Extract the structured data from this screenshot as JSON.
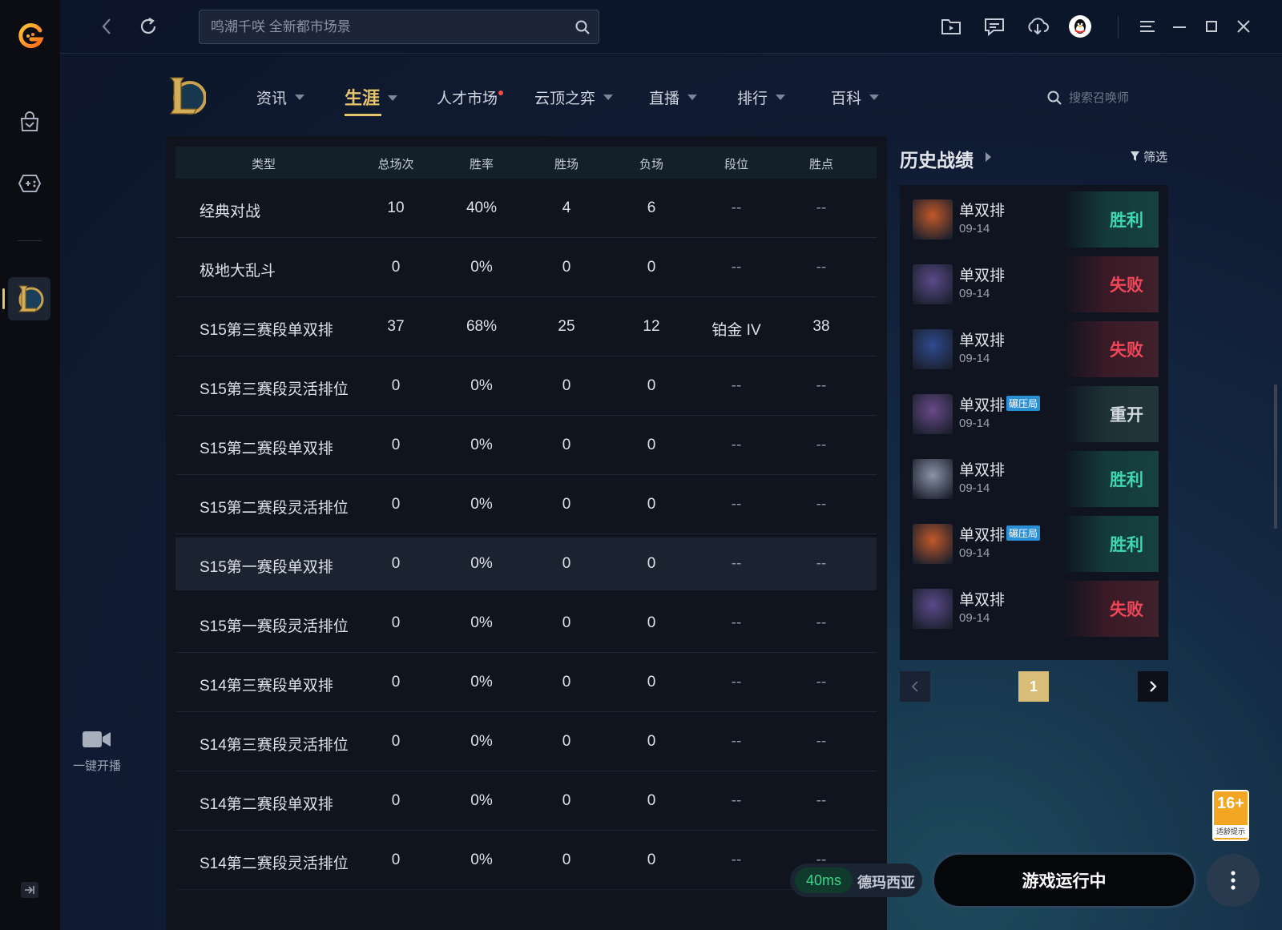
{
  "app": {
    "search": {
      "placeholder": "鸣潮千咲 全新都市场景"
    }
  },
  "game_nav": {
    "items": [
      {
        "label": "资讯",
        "caret": true
      },
      {
        "label": "生涯",
        "caret": true,
        "active": true
      },
      {
        "label": "人才市场",
        "dot": true
      },
      {
        "label": "云顶之弈",
        "caret": true
      },
      {
        "label": "直播",
        "caret": true
      },
      {
        "label": "排行",
        "caret": true
      },
      {
        "label": "百科",
        "caret": true
      }
    ],
    "summoner_search_placeholder": "搜索召唤师"
  },
  "stats_table": {
    "headers": [
      "类型",
      "总场次",
      "胜率",
      "胜场",
      "负场",
      "段位",
      "胜点"
    ],
    "rows": [
      [
        "经典对战",
        "10",
        "40%",
        "4",
        "6",
        "--",
        "--"
      ],
      [
        "极地大乱斗",
        "0",
        "0%",
        "0",
        "0",
        "--",
        "--"
      ],
      [
        "S15第三赛段单双排",
        "37",
        "68%",
        "25",
        "12",
        "铂金 IV",
        "38"
      ],
      [
        "S15第三赛段灵活排位",
        "0",
        "0%",
        "0",
        "0",
        "--",
        "--"
      ],
      [
        "S15第二赛段单双排",
        "0",
        "0%",
        "0",
        "0",
        "--",
        "--"
      ],
      [
        "S15第二赛段灵活排位",
        "0",
        "0%",
        "0",
        "0",
        "--",
        "--"
      ],
      [
        "S15第一赛段单双排",
        "0",
        "0%",
        "0",
        "0",
        "--",
        "--"
      ],
      [
        "S15第一赛段灵活排位",
        "0",
        "0%",
        "0",
        "0",
        "--",
        "--"
      ],
      [
        "S14第三赛段单双排",
        "0",
        "0%",
        "0",
        "0",
        "--",
        "--"
      ],
      [
        "S14第三赛段灵活排位",
        "0",
        "0%",
        "0",
        "0",
        "--",
        "--"
      ],
      [
        "S14第二赛段单双排",
        "0",
        "0%",
        "0",
        "0",
        "--",
        "--"
      ],
      [
        "S14第二赛段灵活排位",
        "0",
        "0%",
        "0",
        "0",
        "--",
        "--"
      ]
    ]
  },
  "history": {
    "title": "历史战绩",
    "filter_label": "筛选",
    "matches": [
      {
        "mode": "单双排",
        "date": "09-14",
        "result": "胜利",
        "result_type": "win",
        "avatar_color": "#c2582a"
      },
      {
        "mode": "单双排",
        "date": "09-14",
        "result": "失败",
        "result_type": "lose",
        "avatar_color": "#5b4a8a"
      },
      {
        "mode": "单双排",
        "date": "09-14",
        "result": "失败",
        "result_type": "lose",
        "avatar_color": "#2f4a8f"
      },
      {
        "mode": "单双排",
        "date": "09-14",
        "result": "重开",
        "result_type": "remake",
        "badge": "碾压局",
        "avatar_color": "#6a4a8a"
      },
      {
        "mode": "单双排",
        "date": "09-14",
        "result": "胜利",
        "result_type": "win",
        "avatar_color": "#8a94a8"
      },
      {
        "mode": "单双排",
        "date": "09-14",
        "result": "胜利",
        "result_type": "win",
        "badge": "碾压局",
        "avatar_color": "#c2582a"
      },
      {
        "mode": "单双排",
        "date": "09-14",
        "result": "失败",
        "result_type": "lose",
        "avatar_color": "#5b4a8a"
      }
    ],
    "current_page": "1"
  },
  "sidebar": {
    "live_label": "一键开播"
  },
  "footer": {
    "ping": "40ms",
    "server": "德玛西亚",
    "run_button": "游戏运行中",
    "age_rating": "16+",
    "age_sub": "适龄提示"
  },
  "colors": {
    "accent": "#e6c46b",
    "win": "#3fd6b4",
    "lose": "#f0485a"
  }
}
